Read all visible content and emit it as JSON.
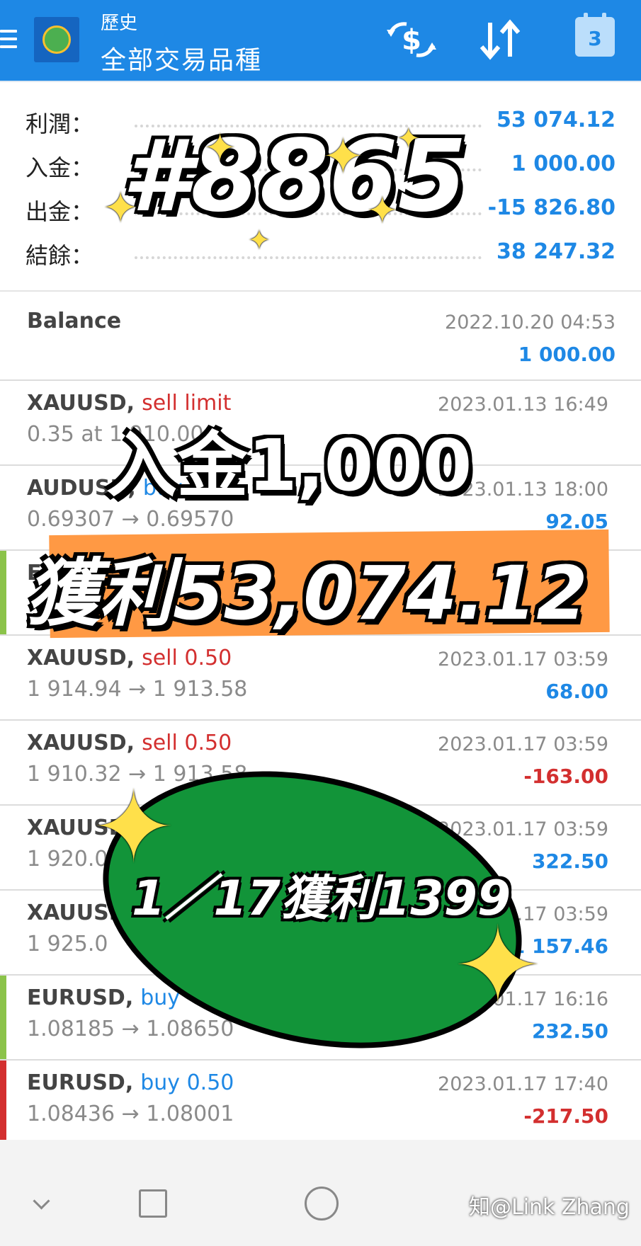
{
  "header": {
    "subtitle": "歷史",
    "title": "全部交易品種",
    "calendar_day": "3"
  },
  "summary": [
    {
      "label": "利潤：",
      "value": "53 074.12"
    },
    {
      "label": "入金：",
      "value": "1 000.00"
    },
    {
      "label": "出金：",
      "value": "-15 826.80"
    },
    {
      "label": "結餘：",
      "value": "38 247.32"
    }
  ],
  "balance": {
    "label": "Balance",
    "datetime": "2022.10.20 04:53",
    "amount": "1 000.00"
  },
  "trades": [
    {
      "symbol": "XAUUSD,",
      "type": "sell limit",
      "type_color": "#d32f2f",
      "sub": "0.35 at 1 910.00",
      "datetime": "2023.01.13 16:49",
      "amount": "",
      "amount_color": "#1e88e5",
      "bar_color": ""
    },
    {
      "symbol": "AUDUSD,",
      "type": "buy 0.35",
      "type_color": "#1e88e5",
      "sub": "0.69307 → 0.69570",
      "datetime": "2023.01.13 18:00",
      "amount": "92.05",
      "amount_color": "#1e88e5",
      "bar_color": ""
    },
    {
      "symbol": "EURUSD,",
      "type": "",
      "type_color": "#1e88e5",
      "sub": "",
      "datetime": "",
      "amount": "",
      "amount_color": "#1e88e5",
      "bar_color": "#8bc34a"
    },
    {
      "symbol": "XAUUSD,",
      "type": "sell 0.50",
      "type_color": "#d32f2f",
      "sub": "1 914.94 → 1 913.58",
      "datetime": "2023.01.17 03:59",
      "amount": "68.00",
      "amount_color": "#1e88e5",
      "bar_color": ""
    },
    {
      "symbol": "XAUUSD,",
      "type": "sell 0.50",
      "type_color": "#d32f2f",
      "sub": "1 910.32 → 1 913.58",
      "datetime": "2023.01.17 03:59",
      "amount": "-163.00",
      "amount_color": "#d32f2f",
      "bar_color": ""
    },
    {
      "symbol": "XAUUSD,",
      "type": "",
      "type_color": "#d32f2f",
      "sub": "1 920.0",
      "datetime": "2023.01.17 03:59",
      "amount": "322.50",
      "amount_color": "#1e88e5",
      "bar_color": ""
    },
    {
      "symbol": "XAUUSD,",
      "type": "",
      "type_color": "#d32f2f",
      "sub": "1 925.0",
      "datetime": "2023.01.17 03:59",
      "amount": "1 157.46",
      "amount_color": "#1e88e5",
      "bar_color": ""
    },
    {
      "symbol": "EURUSD,",
      "type": "buy",
      "type_color": "#1e88e5",
      "sub": "1.08185 → 1.08650",
      "datetime": "2023.01.17 16:16",
      "amount": "232.50",
      "amount_color": "#1e88e5",
      "bar_color": "#8bc34a"
    },
    {
      "symbol": "EURUSD,",
      "type": "buy 0.50",
      "type_color": "#1e88e5",
      "sub": "1.08436 → 1.08001",
      "datetime": "2023.01.17 17:40",
      "amount": "-217.50",
      "amount_color": "#d32f2f",
      "bar_color": "#d32f2f"
    }
  ],
  "overlays": {
    "account_tag": "#8865",
    "deposit": "入金1,000",
    "profit": "獲利53,074.12",
    "daily_profit": "1／17獲利1399"
  },
  "watermark": "知@Link Zhang",
  "icons": [
    "menu-icon",
    "app-logo-icon",
    "currency-exchange-icon",
    "sort-icon",
    "calendar-icon",
    "nav-back-icon",
    "nav-home-icon",
    "nav-recent-icon"
  ]
}
